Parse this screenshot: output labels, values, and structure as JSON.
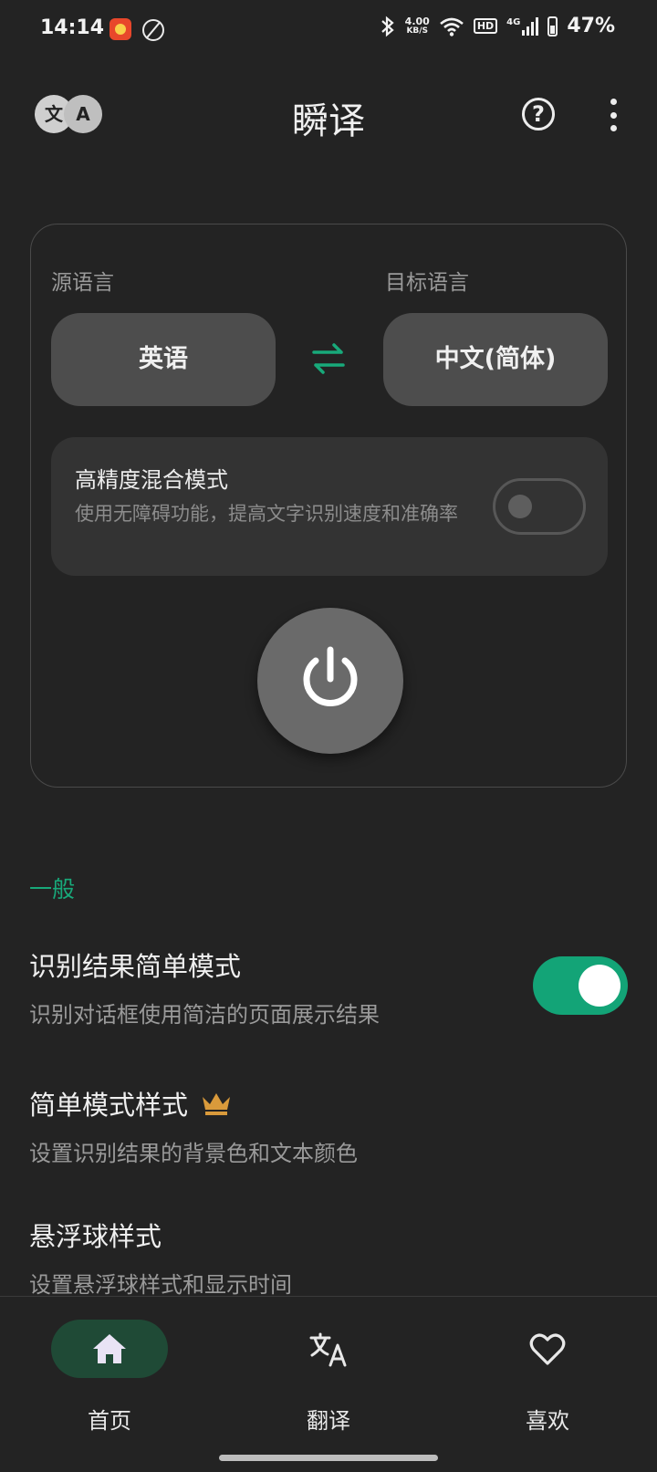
{
  "status_bar": {
    "time": "14:14",
    "net_speed_value": "4.00",
    "net_speed_unit": "KB/S",
    "hd": "HD",
    "network": "4G",
    "battery": "47%"
  },
  "app_bar": {
    "title": "瞬译",
    "logo_left": "文",
    "logo_right": "A"
  },
  "translate_card": {
    "source_label": "源语言",
    "target_label": "目标语言",
    "source_language": "英语",
    "target_language": "中文(简体)",
    "mode_title": "高精度混合模式",
    "mode_desc": "使用无障碍功能，提高文字识别速度和准确率",
    "mode_enabled": false
  },
  "settings": {
    "section_title": "一般",
    "items": [
      {
        "title": "识别结果简单模式",
        "desc": "识别对话框使用简洁的页面展示结果",
        "enabled": true
      },
      {
        "title": "简单模式样式",
        "desc": "设置识别结果的背景色和文本颜色",
        "premium_icon": "crown-icon"
      },
      {
        "title": "悬浮球样式",
        "desc": "设置悬浮球样式和显示时间"
      }
    ]
  },
  "bottom_nav": {
    "items": [
      {
        "label": "首页",
        "icon": "home-icon",
        "active": true
      },
      {
        "label": "翻译",
        "icon": "translate-icon"
      },
      {
        "label": "喜欢",
        "icon": "heart-icon"
      }
    ]
  },
  "colors": {
    "accent": "#18a97a",
    "background": "#232323",
    "crown": "#d99a3b"
  }
}
